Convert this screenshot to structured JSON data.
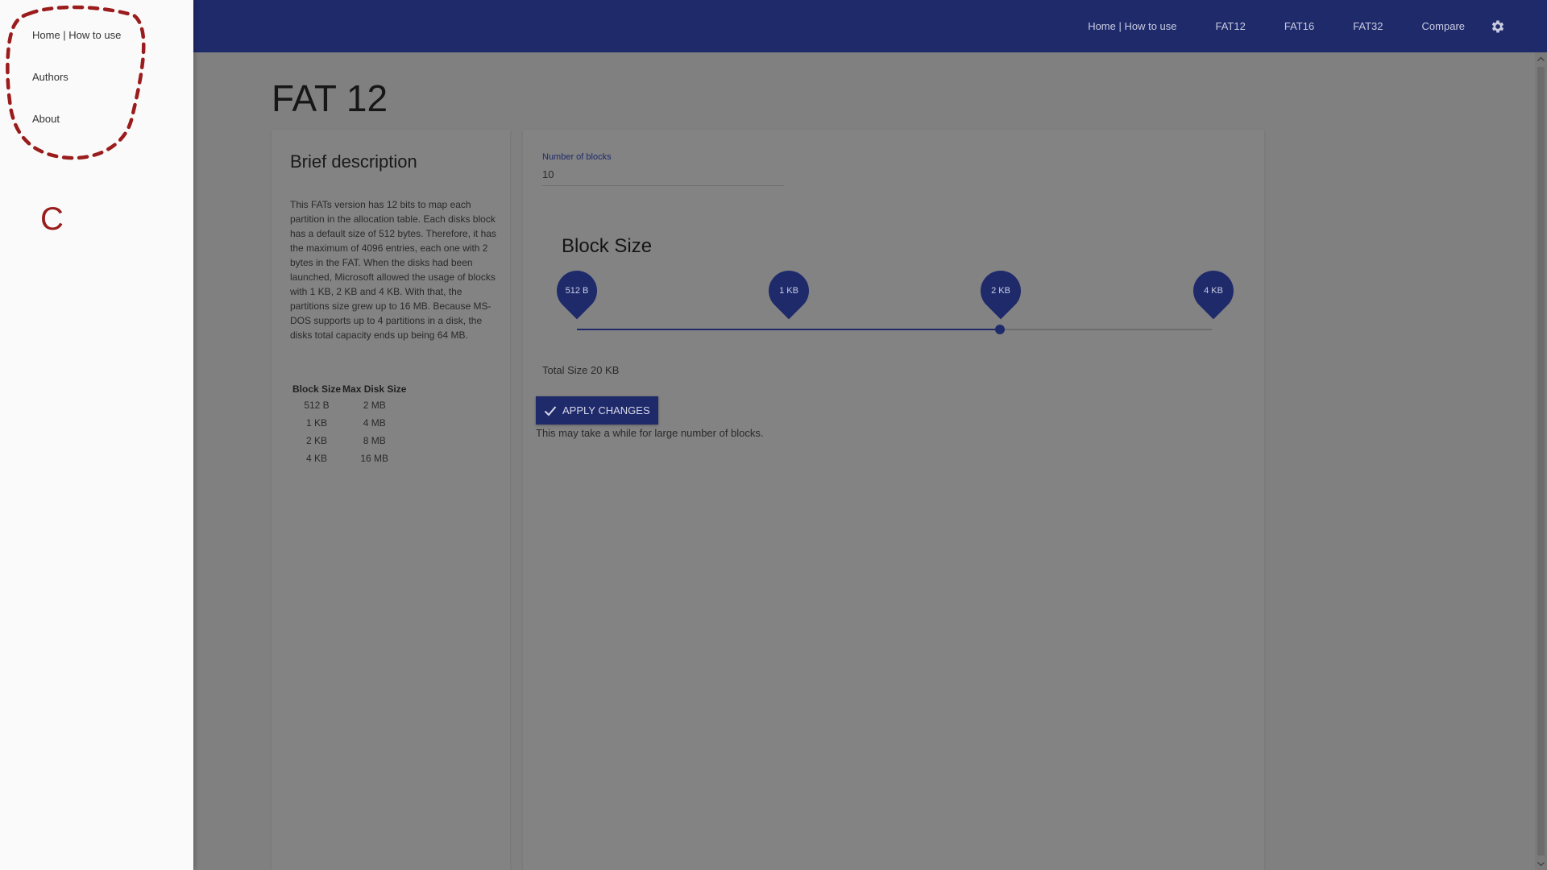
{
  "topbar": {
    "nav": [
      "Home | How to use",
      "FAT12",
      "FAT16",
      "FAT32",
      "Compare"
    ],
    "settings_icon": "gear-icon"
  },
  "drawer": {
    "items": [
      "Home | How to use",
      "Authors",
      "About"
    ]
  },
  "annotation": {
    "letter": "C",
    "color": "#9b1c1c"
  },
  "page": {
    "title": "FAT 12"
  },
  "description": {
    "title": "Brief description",
    "text": "This FATs version has 12 bits to map each partition in the allocation table. Each disks block has a default size of 512 bytes. Therefore, it has the maximum of 4096 entries, each one with 2 bytes in the FAT. When the disks had been launched, Microsoft allowed the usage of blocks with 1 KB, 2 KB and 4 KB. With that, the partitions size grew up to 16 MB. Because MS-DOS supports up to 4 partitions in a disk, the disks total capacity ends up being 64 MB.",
    "table": {
      "headers": [
        "Block Size",
        "Max Disk Size"
      ],
      "rows": [
        [
          "512 B",
          "2 MB"
        ],
        [
          "1 KB",
          "4 MB"
        ],
        [
          "2 KB",
          "8 MB"
        ],
        [
          "4 KB",
          "16 MB"
        ]
      ]
    }
  },
  "form": {
    "blocks_label": "Number of blocks",
    "blocks_value": "10",
    "block_size_title": "Block Size",
    "block_sizes": [
      "512 B",
      "1 KB",
      "2 KB",
      "4 KB"
    ],
    "selected_block_size": "2 KB",
    "total_size": "Total Size 20 KB",
    "apply_label": "APPLY CHANGES",
    "hint": "This may take a while for large number of blocks."
  },
  "colors": {
    "primary": "#1f2a6b",
    "overlay": "#808080",
    "drawer": "#fafafa"
  }
}
